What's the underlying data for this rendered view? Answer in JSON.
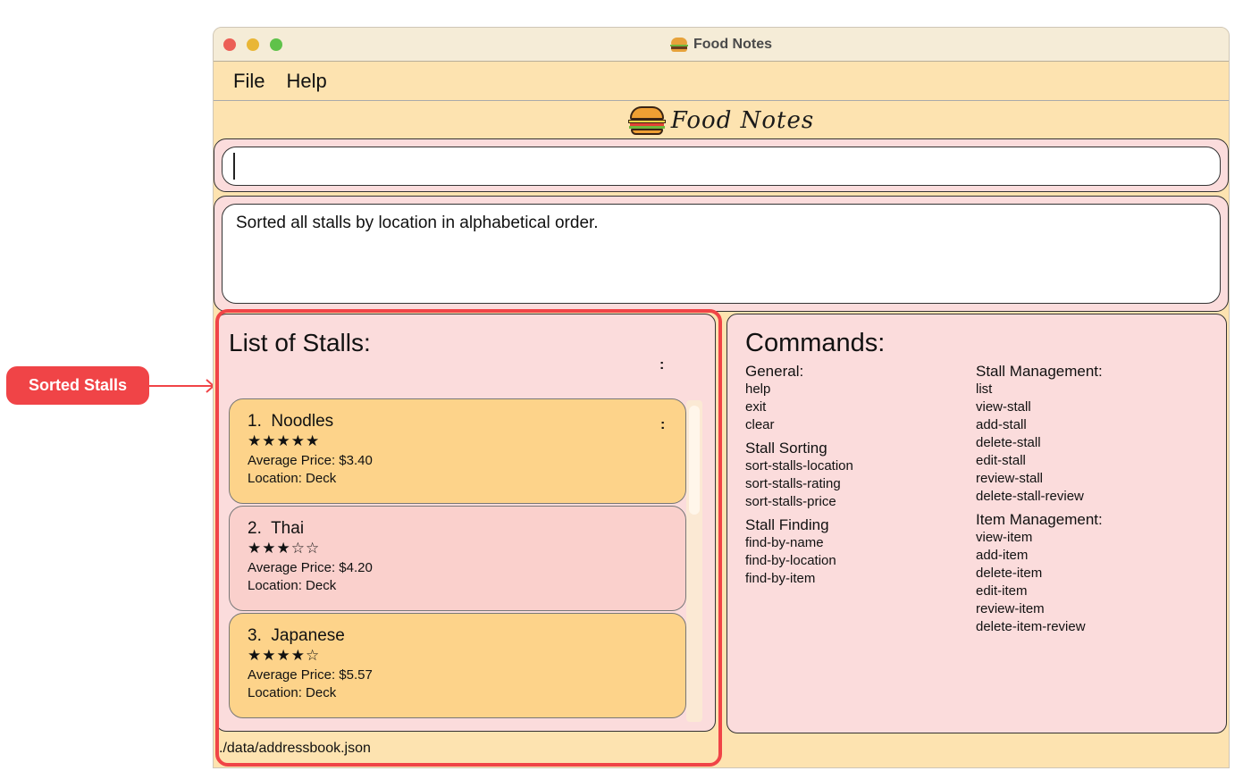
{
  "window": {
    "title": "Food Notes"
  },
  "menu": {
    "file": "File",
    "help": "Help"
  },
  "logo": {
    "text": "Food Notes"
  },
  "command_box": {
    "value": ""
  },
  "result": {
    "message": "Sorted all stalls by location in alphabetical order."
  },
  "stalls_panel": {
    "title": "List of Stalls:",
    "menu_glyph": ":",
    "stalls": [
      {
        "index": "1.",
        "name": "Noodles",
        "stars": "★★★★★",
        "rating": 5,
        "price": "Average Price: $3.40",
        "location": "Location: Deck"
      },
      {
        "index": "2.",
        "name": "Thai",
        "stars": "★★★☆☆",
        "rating": 3,
        "price": "Average Price: $4.20",
        "location": "Location: Deck"
      },
      {
        "index": "3.",
        "name": "Japanese",
        "stars": "★★★★☆",
        "rating": 4,
        "price": "Average Price: $5.57",
        "location": "Location: Deck"
      }
    ]
  },
  "commands_panel": {
    "title": "Commands:",
    "general": {
      "heading": "General:",
      "items": [
        "help",
        "exit",
        "clear"
      ]
    },
    "sorting": {
      "heading": "Stall Sorting",
      "items": [
        "sort-stalls-location",
        "sort-stalls-rating",
        "sort-stalls-price"
      ]
    },
    "finding": {
      "heading": "Stall Finding",
      "items": [
        "find-by-name",
        "find-by-location",
        "find-by-item"
      ]
    },
    "stall_mgmt": {
      "heading": "Stall Management:",
      "items": [
        "list",
        "view-stall",
        "add-stall",
        "delete-stall",
        "edit-stall",
        "review-stall",
        "delete-stall-review"
      ]
    },
    "item_mgmt": {
      "heading": "Item Management:",
      "items": [
        "view-item",
        "add-item",
        "delete-item",
        "edit-item",
        "review-item",
        "delete-item-review"
      ]
    }
  },
  "status": {
    "path": "./data/addressbook.json"
  },
  "annotation": {
    "label": "Sorted Stalls",
    "color": "#f04447"
  }
}
